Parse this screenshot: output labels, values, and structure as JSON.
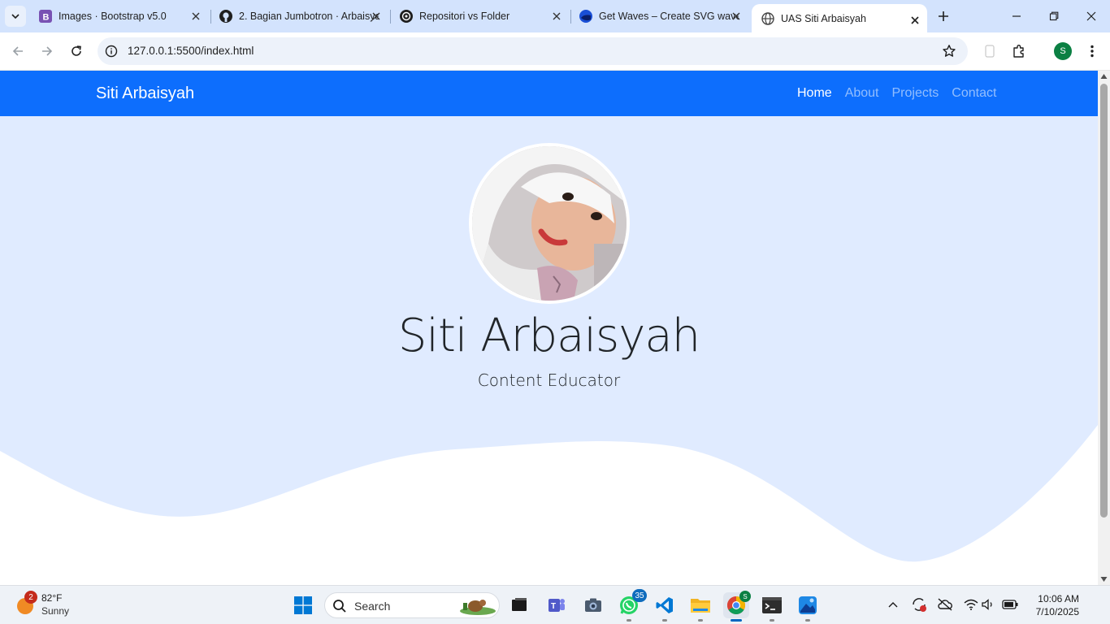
{
  "browser": {
    "tabs": [
      {
        "title": "Images · Bootstrap v5.0",
        "icon": "bootstrap-icon"
      },
      {
        "title": "2. Bagian Jumbotron · Arbaisyah",
        "icon": "github-icon"
      },
      {
        "title": "Repositori vs Folder",
        "icon": "chatgpt-icon"
      },
      {
        "title": "Get Waves – Create SVG waves",
        "icon": "getwaves-icon"
      },
      {
        "title": "UAS Siti Arbaisyah",
        "icon": "globe-icon",
        "active": true
      }
    ],
    "url": "127.0.0.1:5500/index.html",
    "profile_initial": "S",
    "accent_color": "#d3e3fd"
  },
  "page": {
    "navbar": {
      "brand": "Siti Arbaisyah",
      "links": [
        "Home",
        "About",
        "Projects",
        "Contact"
      ],
      "active_link": "Home",
      "color": "#0d6efd"
    },
    "hero": {
      "name": "Siti Arbaisyah",
      "role": "Content Educator",
      "background": "#e0ebff"
    }
  },
  "taskbar": {
    "weather": {
      "temp": "82°F",
      "condition": "Sunny",
      "badge": "2"
    },
    "search_label": "Search",
    "whatsapp_badge": "35",
    "chrome_badge": "S",
    "clock": {
      "time": "10:06 AM",
      "date": "7/10/2025"
    }
  }
}
